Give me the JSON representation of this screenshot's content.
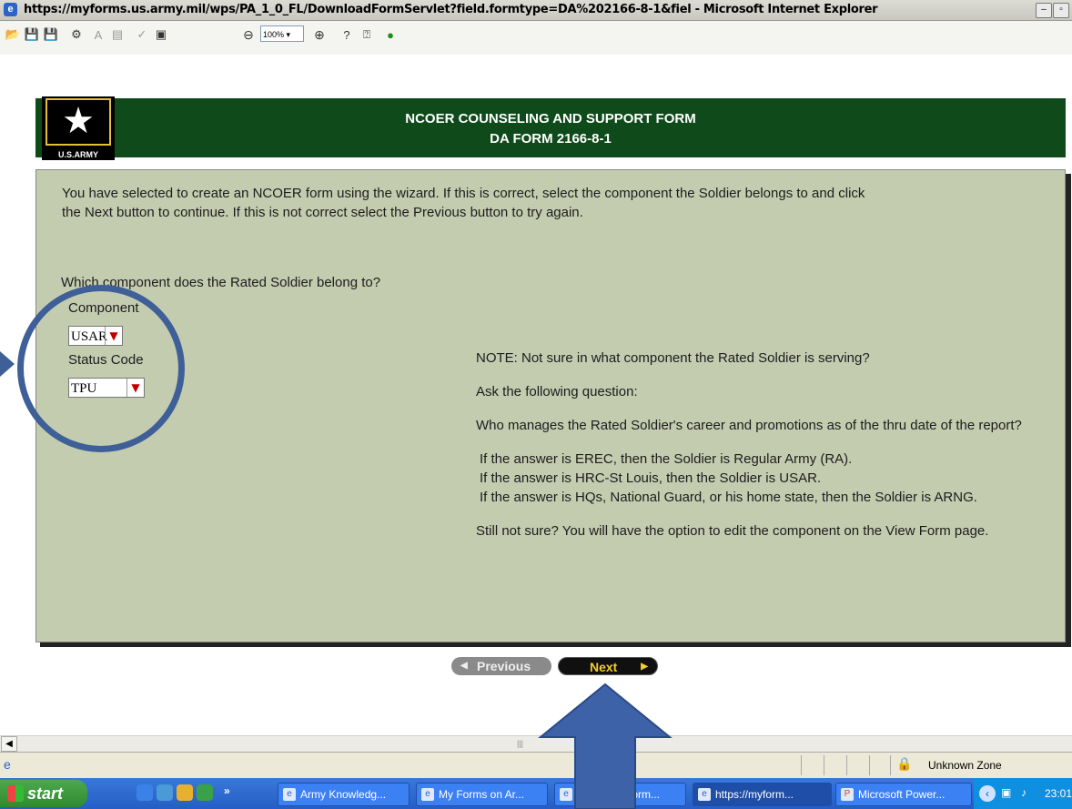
{
  "window": {
    "title": "https://myforms.us.army.mil/wps/PA_1_0_FL/DownloadFormServlet?field.formtype=DA%202166-8-1&fiel - Microsoft Internet Explorer",
    "minimize_label": "–",
    "restore_label": "▫"
  },
  "toolbar": {
    "zoom_value": "100%",
    "icons": [
      "open-icon",
      "save-icon",
      "save-as-icon",
      "print-icon",
      "text-icon",
      "form-icon",
      "spell-icon",
      "image-icon",
      "zoom-out-icon",
      "zoom-select",
      "zoom-in-icon",
      "help-icon",
      "about-icon",
      "go-icon"
    ]
  },
  "header": {
    "title_line1": "NCOER COUNSELING AND SUPPORT FORM",
    "title_line2": "DA FORM 2166-8-1",
    "logo_text": "U.S.ARMY"
  },
  "form": {
    "intro": "You have selected to create an NCOER form using the wizard. If this is correct, select the component the Soldier belongs to and click the Next button to continue. If this is not correct select the Previous button to try again.",
    "question": "Which component does the Rated Soldier belong to?",
    "component_label": "Component",
    "component_value": "USAR",
    "status_label": "Status Code",
    "status_value": "TPU",
    "note": {
      "p1": "NOTE:  Not sure in what component the Rated Soldier is serving?",
      "p2": "Ask the following question:",
      "p3": "Who manages the Rated Soldier's career and promotions as of the thru date of the report?",
      "a1": "If the answer is EREC, then the Soldier is Regular Army (RA).",
      "a2": "If the answer is HRC-St Louis, then the Soldier is USAR.",
      "a3": "If the answer is HQs, National Guard, or his home state, then the Soldier is ARNG.",
      "p4": "Still not sure?  You will have the option to edit the component on the View Form page."
    }
  },
  "nav": {
    "previous_label": "Previous",
    "next_label": "Next"
  },
  "statusbar": {
    "zone": "Unknown Zone"
  },
  "taskbar": {
    "start_label": "start",
    "tasks": [
      {
        "label": "Army Knowledg..."
      },
      {
        "label": "My Forms on Ar..."
      },
      {
        "label": "yform..."
      },
      {
        "label": "https://myform..."
      },
      {
        "label": "Microsoft Power..."
      }
    ],
    "clock": "23:01"
  },
  "colors": {
    "banner": "#0f4a1b",
    "panel": "#c4ccb0",
    "annotation": "#3e5f97",
    "next_text": "#f4cc2c"
  }
}
